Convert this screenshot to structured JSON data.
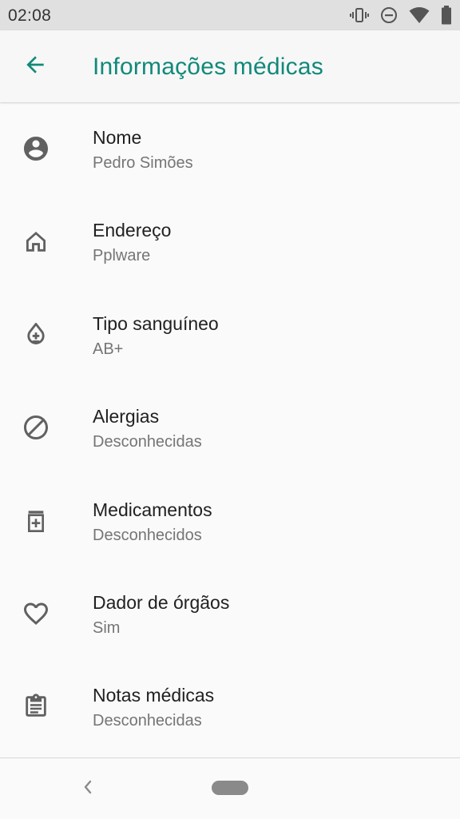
{
  "status_bar": {
    "time": "02:08",
    "icons": [
      "vibrate-icon",
      "do-not-disturb-icon",
      "wifi-icon",
      "battery-icon"
    ]
  },
  "app_bar": {
    "back_icon": "arrow-back-icon",
    "title": "Informações médicas"
  },
  "items": [
    {
      "icon": "account-circle-icon",
      "title": "Nome",
      "subtitle": "Pedro Simões"
    },
    {
      "icon": "home-icon",
      "title": "Endereço",
      "subtitle": "Pplware"
    },
    {
      "icon": "blood-drop-icon",
      "title": "Tipo sanguíneo",
      "subtitle": "AB+"
    },
    {
      "icon": "block-icon",
      "title": "Alergias",
      "subtitle": "Desconhecidas"
    },
    {
      "icon": "medication-icon",
      "title": "Medicamentos",
      "subtitle": "Desconhecidos"
    },
    {
      "icon": "heart-outline-icon",
      "title": "Dador de órgãos",
      "subtitle": "Sim"
    },
    {
      "icon": "clipboard-icon",
      "title": "Notas médicas",
      "subtitle": "Desconhecidas"
    }
  ],
  "nav_bar": {
    "back_icon": "nav-back-icon",
    "home_icon": "home-pill"
  },
  "colors": {
    "accent": "#11897a",
    "status_bar_bg": "#e0e0e0",
    "background": "#fafafa",
    "icon": "#616161"
  }
}
